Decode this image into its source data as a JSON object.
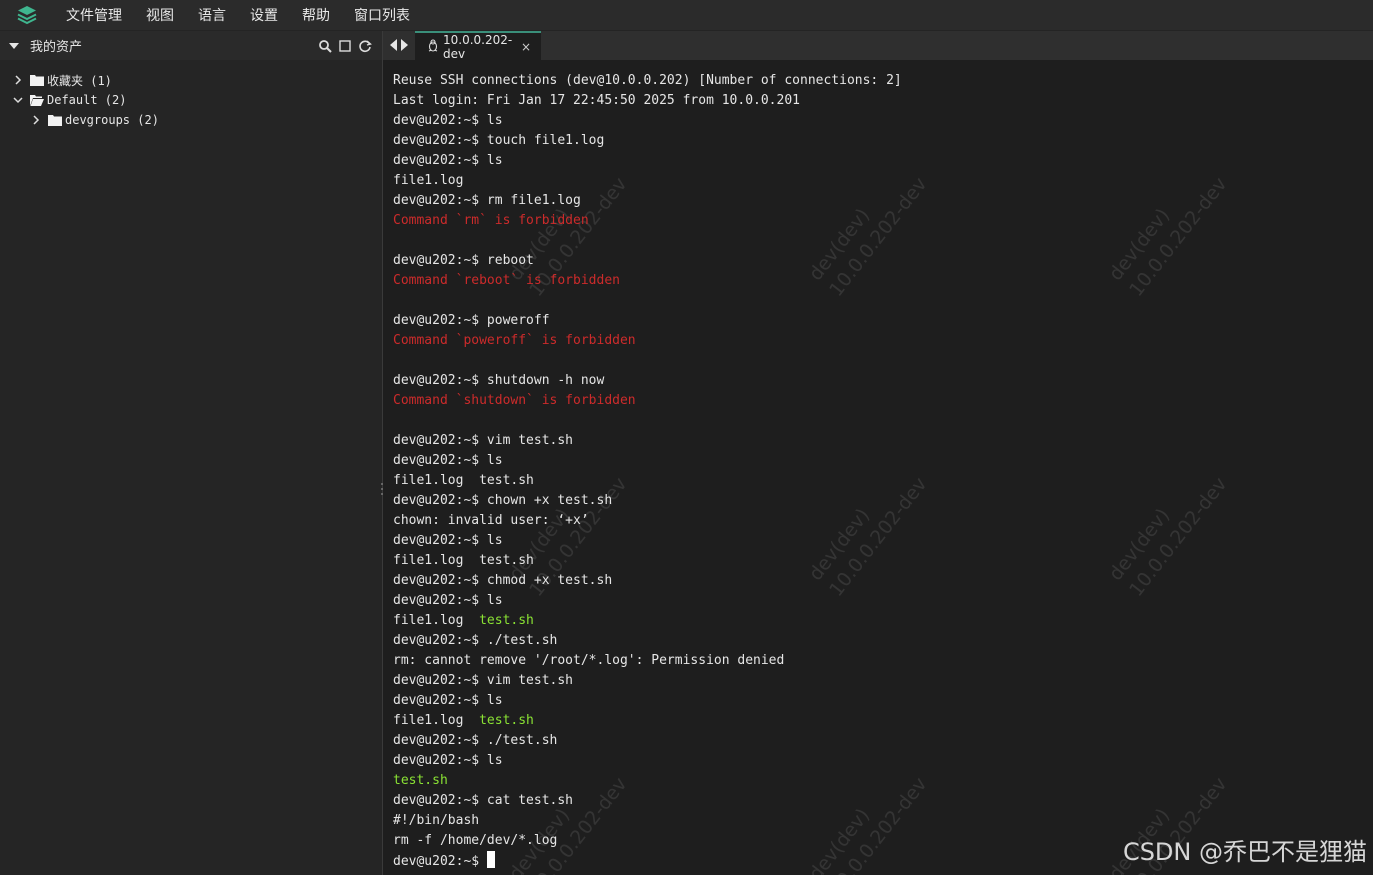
{
  "menubar": {
    "logo_icon": "stack-layers-icon",
    "items": [
      "文件管理",
      "视图",
      "语言",
      "设置",
      "帮助",
      "窗口列表"
    ]
  },
  "assets": {
    "title": "我的资产",
    "tree": [
      {
        "label": "收藏夹 (1)",
        "expanded": false,
        "level": 0
      },
      {
        "label": "Default (2)",
        "expanded": true,
        "level": 0
      },
      {
        "label": "devgroups (2)",
        "expanded": false,
        "level": 1
      }
    ]
  },
  "tab": {
    "label": "10.0.0.202-dev",
    "close": "×",
    "icon": "linux-penguin-icon",
    "accent": "#3a8f7a"
  },
  "terminal": {
    "lines": [
      {
        "t": "Reuse SSH connections (dev@10.0.0.202) [Number of connections: 2]",
        "c": ""
      },
      {
        "t": "Last login: Fri Jan 17 22:45:50 2025 from 10.0.0.201",
        "c": ""
      },
      {
        "t": "dev@u202:~$ ls",
        "c": ""
      },
      {
        "t": "dev@u202:~$ touch file1.log",
        "c": ""
      },
      {
        "t": "dev@u202:~$ ls",
        "c": ""
      },
      {
        "t": "file1.log",
        "c": ""
      },
      {
        "t": "dev@u202:~$ rm file1.log",
        "c": ""
      },
      {
        "t": "Command `rm` is forbidden",
        "c": "err"
      },
      {
        "t": "",
        "c": ""
      },
      {
        "t": "dev@u202:~$ reboot",
        "c": ""
      },
      {
        "t": "Command `reboot` is forbidden",
        "c": "err"
      },
      {
        "t": "",
        "c": ""
      },
      {
        "t": "dev@u202:~$ poweroff",
        "c": ""
      },
      {
        "t": "Command `poweroff` is forbidden",
        "c": "err"
      },
      {
        "t": "",
        "c": ""
      },
      {
        "t": "dev@u202:~$ shutdown -h now",
        "c": ""
      },
      {
        "t": "Command `shutdown` is forbidden",
        "c": "err"
      },
      {
        "t": "",
        "c": ""
      },
      {
        "t": "dev@u202:~$ vim test.sh",
        "c": ""
      },
      {
        "t": "dev@u202:~$ ls",
        "c": ""
      },
      {
        "t": "file1.log  test.sh",
        "c": ""
      },
      {
        "t": "dev@u202:~$ chown +x test.sh",
        "c": ""
      },
      {
        "t": "chown: invalid user: ‘+x’",
        "c": ""
      },
      {
        "t": "dev@u202:~$ ls",
        "c": ""
      },
      {
        "t": "file1.log  test.sh",
        "c": ""
      },
      {
        "t": "dev@u202:~$ chmod +x test.sh",
        "c": ""
      },
      {
        "t": "dev@u202:~$ ls",
        "c": ""
      },
      {
        "t": "file1.log  ",
        "c": "",
        "g": "test.sh"
      },
      {
        "t": "dev@u202:~$ ./test.sh",
        "c": ""
      },
      {
        "t": "rm: cannot remove '/root/*.log': Permission denied",
        "c": ""
      },
      {
        "t": "dev@u202:~$ vim test.sh",
        "c": ""
      },
      {
        "t": "dev@u202:~$ ls",
        "c": ""
      },
      {
        "t": "file1.log  ",
        "c": "",
        "g": "test.sh"
      },
      {
        "t": "dev@u202:~$ ./test.sh",
        "c": ""
      },
      {
        "t": "dev@u202:~$ ls",
        "c": ""
      },
      {
        "t": "",
        "c": "",
        "g": "test.sh"
      },
      {
        "t": "dev@u202:~$ cat test.sh",
        "c": ""
      },
      {
        "t": "#!/bin/bash",
        "c": ""
      },
      {
        "t": "rm -f /home/dev/*.log",
        "c": ""
      },
      {
        "t": "dev@u202:~$ ",
        "c": "",
        "cursor": true
      }
    ],
    "error_color": "#cc2b2b",
    "exec_color": "#8ae234"
  },
  "watermark": {
    "line1": "dev(dev)",
    "line2": "10.0.0.202-dev"
  },
  "credit": "CSDN @乔巴不是狸猫"
}
